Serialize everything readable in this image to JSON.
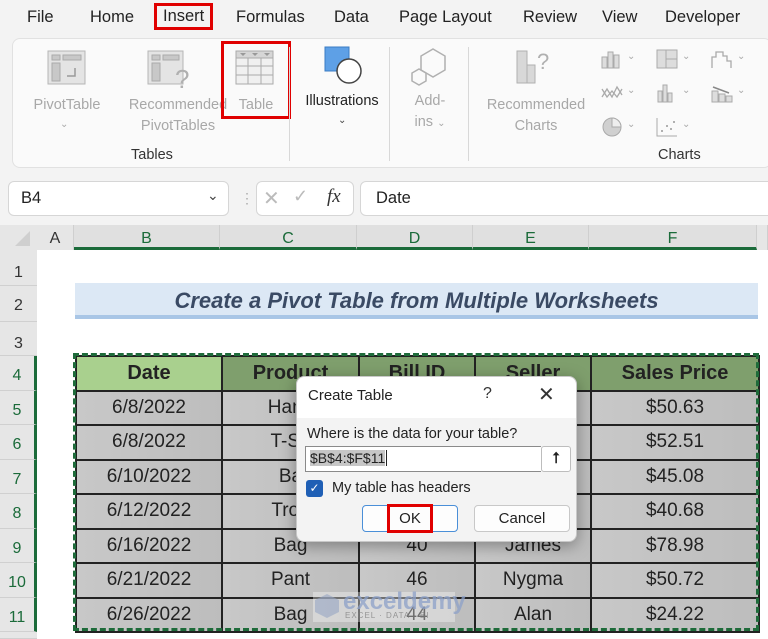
{
  "menu_tabs": [
    {
      "label": "File"
    },
    {
      "label": "Home"
    },
    {
      "label": "Insert",
      "active": true
    },
    {
      "label": "Formulas"
    },
    {
      "label": "Data"
    },
    {
      "label": "Page Layout"
    },
    {
      "label": "Review"
    },
    {
      "label": "View"
    },
    {
      "label": "Developer"
    }
  ],
  "ribbon": {
    "pivot_table": "PivotTable",
    "recommended_pivot_1": "Recommended",
    "recommended_pivot_2": "PivotTables",
    "table": "Table",
    "tables_group": "Tables",
    "illustrations": "Illustrations",
    "addins_1": "Add-",
    "addins_2": "ins",
    "recommended_charts_1": "Recommended",
    "recommended_charts_2": "Charts",
    "charts_group": "Charts"
  },
  "formula_bar": {
    "name_box": "B4",
    "fx": "fx",
    "value": "Date"
  },
  "columns": [
    "A",
    "B",
    "C",
    "D",
    "E",
    "F"
  ],
  "rows": [
    "1",
    "2",
    "3",
    "4",
    "5",
    "6",
    "7",
    "8",
    "9",
    "10",
    "11"
  ],
  "sheet": {
    "title": "Create a Pivot Table from Multiple Worksheets",
    "headers": [
      "Date",
      "Product",
      "Bill ID",
      "Seller",
      "Sales Price"
    ],
    "data": [
      [
        "6/8/2022",
        "Hand",
        "",
        "",
        "$50.63"
      ],
      [
        "6/8/2022",
        "T-Sh",
        "",
        "",
        "$52.51"
      ],
      [
        "6/10/2022",
        "Ba",
        "",
        "",
        "$45.08"
      ],
      [
        "6/12/2022",
        "Trou",
        "",
        "",
        "$40.68"
      ],
      [
        "6/16/2022",
        "Bag",
        "40",
        "James",
        "$78.98"
      ],
      [
        "6/21/2022",
        "Pant",
        "46",
        "Nygma",
        "$50.72"
      ],
      [
        "6/26/2022",
        "Bag",
        "44",
        "Alan",
        "$24.22"
      ]
    ]
  },
  "dialog": {
    "title": "Create Table",
    "help": "?",
    "close": "✕",
    "prompt": "Where is the data for your table?",
    "range_value": "$B$4:$F$11",
    "collapse_icon": "⭡",
    "checkbox_label": "My table has headers",
    "checkbox_checked": true,
    "ok": "OK",
    "cancel": "Cancel"
  },
  "watermark": {
    "name": "exceldemy",
    "tagline": "EXCEL · DATA · BI"
  }
}
